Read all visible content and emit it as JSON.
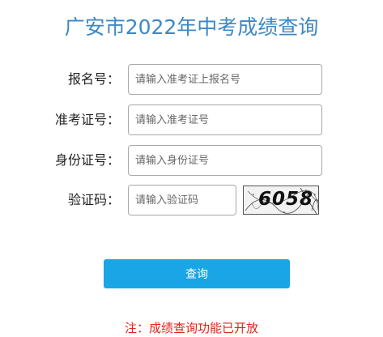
{
  "page": {
    "title": "广安市2022年中考成绩查询"
  },
  "form": {
    "registration": {
      "label": "报名号：",
      "placeholder": "请输入准考证上报名号"
    },
    "admission": {
      "label": "准考证号：",
      "placeholder": "请输入准考证号"
    },
    "id_number": {
      "label": "身份证号：",
      "placeholder": "请输入身份证号"
    },
    "captcha": {
      "label": "验证码：",
      "placeholder": "请输入验证码",
      "image_text": "6058"
    },
    "submit_label": "查询"
  },
  "notice": "注：成绩查询功能已开放",
  "colors": {
    "title": "#3d88c4",
    "button": "#1aa5e6",
    "notice": "#e0241b"
  }
}
